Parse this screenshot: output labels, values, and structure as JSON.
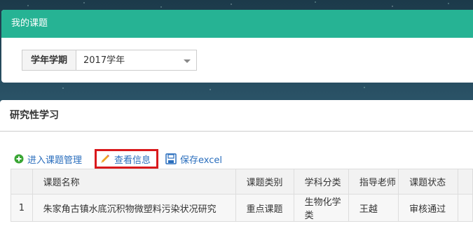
{
  "my_topics": {
    "title": "我的课题"
  },
  "term_filter": {
    "label": "学年学期",
    "selected": "2017学年"
  },
  "research": {
    "title": "研究性学习"
  },
  "toolbar": {
    "enter_label": "进入课题管理",
    "view_label": "查看信息",
    "save_label": "保存excel"
  },
  "table": {
    "headers": [
      "",
      "课题名称",
      "课题类别",
      "学科分类",
      "指导老师",
      "课题状态"
    ],
    "rows": [
      [
        "1",
        "朱家角古镇水底沉积物微塑料污染状况研究",
        "重点课题",
        "生物化学类",
        "王越",
        "审核通过"
      ]
    ]
  },
  "colors": {
    "header_green": "#26b394",
    "highlight_red": "#d9191c",
    "link_blue": "#2a6ebd"
  },
  "icons": {
    "enter": "plus-circle-icon",
    "view": "pencil-icon",
    "save": "floppy-disk-icon"
  }
}
